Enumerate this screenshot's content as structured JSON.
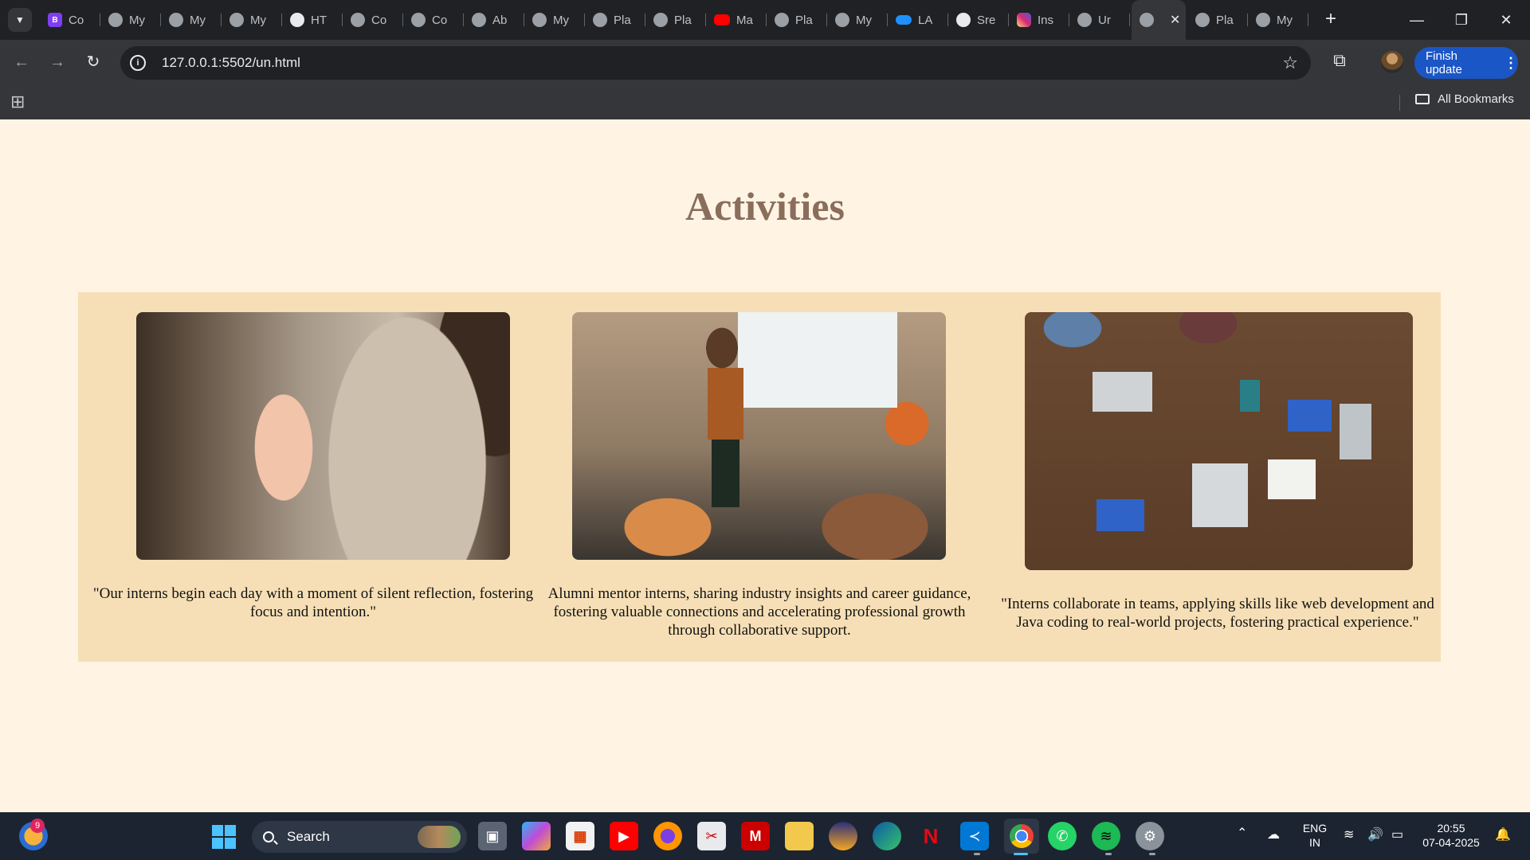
{
  "browser": {
    "tabs": [
      {
        "title": "Co",
        "icon": "b-app-icon"
      },
      {
        "title": "My",
        "icon": "globe-icon"
      },
      {
        "title": "My",
        "icon": "globe-icon"
      },
      {
        "title": "My",
        "icon": "globe-icon"
      },
      {
        "title": "HT",
        "icon": "openai-icon"
      },
      {
        "title": "Co",
        "icon": "globe-icon"
      },
      {
        "title": "Co",
        "icon": "globe-icon"
      },
      {
        "title": "Ab",
        "icon": "globe-icon"
      },
      {
        "title": "My",
        "icon": "globe-icon"
      },
      {
        "title": "Pla",
        "icon": "globe-icon"
      },
      {
        "title": "Pla",
        "icon": "globe-icon"
      },
      {
        "title": "Ma",
        "icon": "youtube-icon"
      },
      {
        "title": "Pla",
        "icon": "globe-icon"
      },
      {
        "title": "My",
        "icon": "globe-icon"
      },
      {
        "title": "LA",
        "icon": "onedrive-icon"
      },
      {
        "title": "Sre",
        "icon": "github-icon"
      },
      {
        "title": "Ins",
        "icon": "instagram-icon"
      },
      {
        "title": "Ur",
        "icon": "globe-icon"
      },
      {
        "title": "",
        "icon": "globe-icon",
        "active": true
      },
      {
        "title": "Pla",
        "icon": "globe-icon"
      },
      {
        "title": "My",
        "icon": "globe-icon"
      }
    ],
    "url": "127.0.0.1:5502/un.html",
    "finish_update_label": "Finish update",
    "all_bookmarks_label": "All Bookmarks"
  },
  "page": {
    "heading": "Activities",
    "cards": [
      {
        "caption": "\"Our interns begin each day with a moment of silent reflection, fostering focus and intention.\"",
        "image": "woman with clasped hands in reflection"
      },
      {
        "caption": "Alumni mentor interns, sharing industry insights and career guidance, fostering valuable connections and accelerating professional growth through collaborative support.",
        "image": "mentor presenting to a group"
      },
      {
        "caption": "\"Interns collaborate in teams, applying skills like web development and Java coding to real-world projects, fostering practical experience.\"",
        "image": "team working around a table with laptops"
      }
    ]
  },
  "taskbar": {
    "notification_count": "9",
    "search_label": "Search",
    "language_line1": "ENG",
    "language_line2": "IN",
    "time": "20:55",
    "date": "07-04-2025"
  },
  "colors": {
    "page_background": "#fff4e4",
    "panel_background": "#f6dfb6",
    "heading_color": "#8b6d5c",
    "browser_chrome": "#35363a",
    "finish_update_button": "#1a56c6"
  }
}
